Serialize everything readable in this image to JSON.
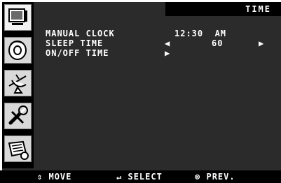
{
  "title": "TIME",
  "rows": [
    {
      "label": "MANUAL CLOCK",
      "value": "12:30  AM"
    },
    {
      "label": "SLEEP TIME",
      "value": "60",
      "left_arrow": "◀",
      "right_arrow": "▶"
    },
    {
      "label": "ON/OFF TIME",
      "arrow": "▶"
    }
  ],
  "sidebar": [
    {
      "icon": "picture-icon",
      "active": true
    },
    {
      "icon": "sound-icon",
      "active": false
    },
    {
      "icon": "channel-icon",
      "active": false
    },
    {
      "icon": "setup-icon",
      "active": false
    },
    {
      "icon": "time-icon",
      "active": false
    }
  ],
  "footer": {
    "move_icon": "⇕",
    "move": "MOVE",
    "select_icon": "↵",
    "select": "SELECT",
    "prev_icon": "⊗",
    "prev": "PREV."
  },
  "colors": {
    "panel": "#2b2b2b",
    "text": "#ffffff",
    "bar": "#000000"
  }
}
